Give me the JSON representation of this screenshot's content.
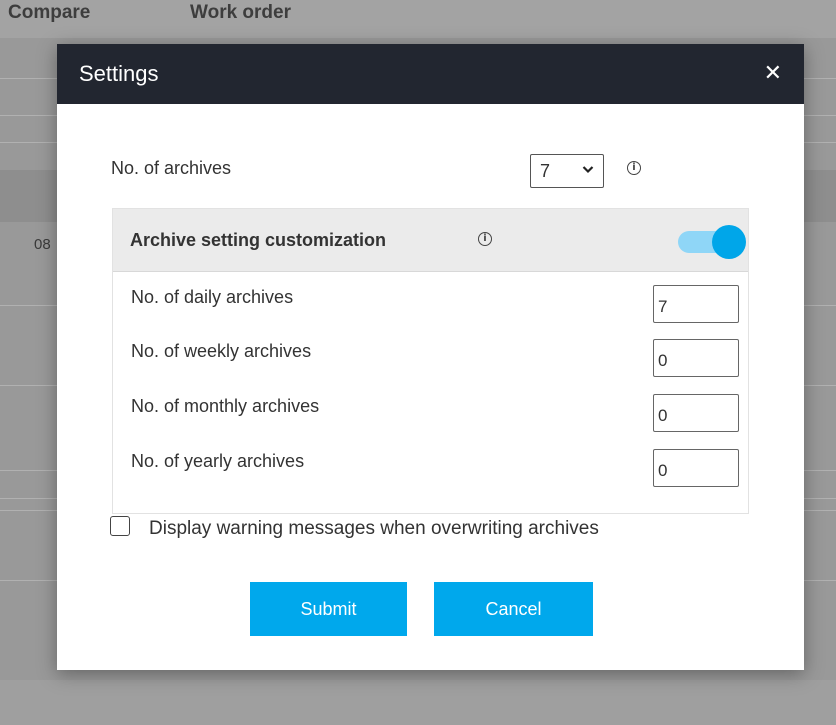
{
  "background": {
    "columns": [
      "Compare",
      "Work order"
    ],
    "cell_text": "08"
  },
  "dialog": {
    "title": "Settings",
    "close_icon": "close-icon",
    "archives": {
      "label": "No. of archives",
      "selected": "7"
    },
    "customization": {
      "title": "Archive setting customization",
      "toggle_on": true,
      "fields": [
        {
          "label": "No. of daily archives",
          "value": "7"
        },
        {
          "label": "No. of weekly archives",
          "value": "0"
        },
        {
          "label": "No. of monthly archives",
          "value": "0"
        },
        {
          "label": "No. of yearly archives",
          "value": "0"
        }
      ]
    },
    "warning_checkbox": {
      "label": "Display warning messages when overwriting archives",
      "checked": false
    },
    "buttons": {
      "submit": "Submit",
      "cancel": "Cancel"
    }
  },
  "colors": {
    "header_bg": "#222630",
    "accent": "#00a8ec",
    "toggle_track": "#8fd6f7"
  }
}
